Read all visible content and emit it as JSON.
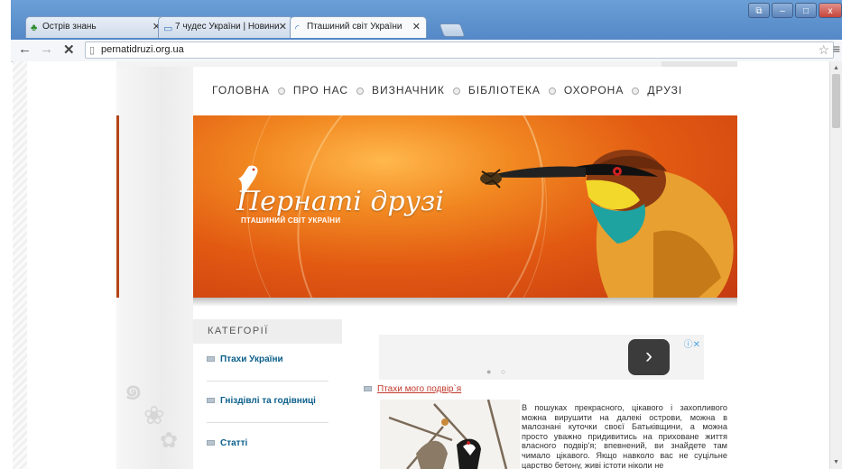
{
  "browser": {
    "tabs": [
      {
        "label": "Острів знань",
        "icon": "tree-icon"
      },
      {
        "label": "7 чудес України | Новини",
        "icon": "monitor-icon"
      },
      {
        "label": "Пташиний світ України",
        "icon": "loading-icon"
      }
    ],
    "address": "pernatidruzi.org.ua",
    "window_buttons": {
      "restore": "⧉",
      "minimize": "–",
      "maximize": "□",
      "close": "x"
    }
  },
  "site": {
    "nav": [
      "ГОЛОВНА",
      "ПРО НАС",
      "ВИЗНАЧНИК",
      "БІБЛІОТЕКА",
      "ОХОРОНА",
      "ДРУЗІ"
    ],
    "banner": {
      "logo_text": "Пернаті друзі",
      "subtitle": "ПТАШИНИЙ СВІТ УКРАЇНИ"
    },
    "categories": {
      "heading": "КАТЕГОРІЇ",
      "items": [
        "Птахи України",
        "Гніздівлі та годівниці",
        "Статті"
      ]
    },
    "ad": {
      "arrow": "›",
      "icons": "ⓘ✕",
      "dots": "● ○"
    },
    "article": {
      "link": "Птахи мого подвір`я",
      "text": "В пошуках прекрасного, цікавого і захопливого можна вирушити на далекі острови, можна в малознані куточки своєї Батьківщини, а можна просто уважно придивитись на приховане життя власного подвір'я; впевнений, ви знайдете там чимало цікавого. Якщо навколо вас не суцільне царство бетону, живі істоти ніколи не"
    }
  },
  "colors": {
    "accent_orange": "#e25a12",
    "link_blue": "#0b5f8a",
    "link_red": "#c0392b"
  }
}
